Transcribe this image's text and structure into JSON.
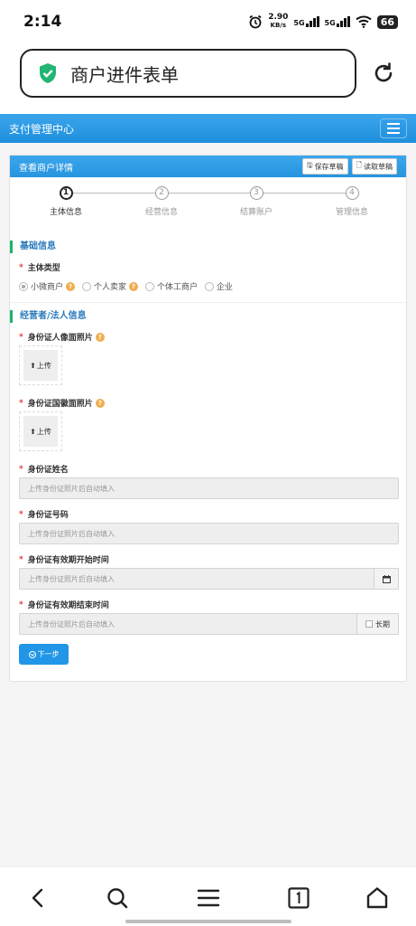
{
  "status": {
    "time": "2:14",
    "net_speed": "2.90",
    "net_unit": "KB/s",
    "sig1": "5G",
    "sig2": "5G",
    "battery": "66"
  },
  "browser": {
    "page_title": "商户进件表单"
  },
  "navbar": {
    "brand": "支付管理中心"
  },
  "panel": {
    "title": "查看商户详情",
    "save_draft": "保存草稿",
    "read_draft": "读取草稿"
  },
  "steps": [
    {
      "num": "1",
      "label": "主体信息",
      "active": true
    },
    {
      "num": "2",
      "label": "经营信息",
      "active": false
    },
    {
      "num": "3",
      "label": "结算账户",
      "active": false
    },
    {
      "num": "4",
      "label": "管理信息",
      "active": false
    }
  ],
  "form": {
    "section_basic": "基础信息",
    "entity_type_label": "主体类型",
    "entity_options": [
      "小微商户",
      "个人卖家",
      "个体工商户",
      "企业"
    ],
    "section_operator": "经营者/法人信息",
    "id_front_label": "身份证人像面照片",
    "id_back_label": "身份证国徽面照片",
    "upload_label": "上传",
    "id_name_label": "身份证姓名",
    "id_number_label": "身份证号码",
    "id_start_label": "身份证有效期开始时间",
    "id_end_label": "身份证有效期结束时间",
    "auto_fill_placeholder": "上传身份证照片后自动填入",
    "long_term_label": "长期",
    "required_mark": "*",
    "next_button": "下一步"
  }
}
